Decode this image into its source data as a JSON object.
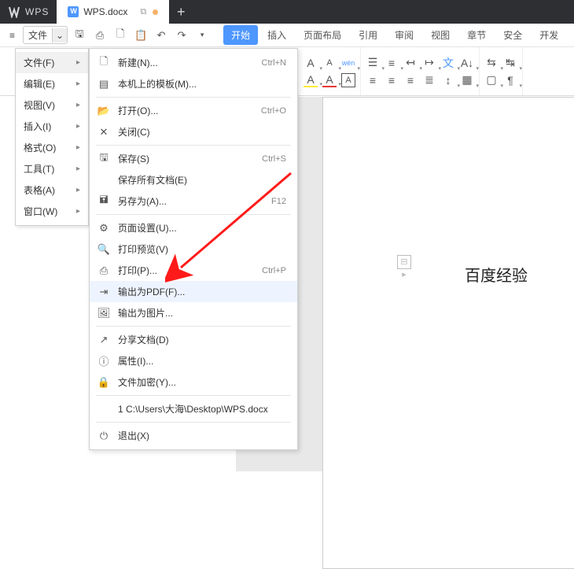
{
  "app": {
    "name": "WPS"
  },
  "tab": {
    "document_name": "WPS.docx"
  },
  "menu": {
    "file_label": "文件",
    "hamburger": "≡"
  },
  "ribbon_tabs": {
    "start": "开始",
    "insert": "插入",
    "layout": "页面布局",
    "reference": "引用",
    "review": "审阅",
    "view": "视图",
    "section": "章节",
    "security": "安全",
    "dev": "开发"
  },
  "file_menu": {
    "items": [
      {
        "label": "文件(F)",
        "has_sub": true,
        "highlighted": true
      },
      {
        "label": "编辑(E)",
        "has_sub": true
      },
      {
        "label": "视图(V)",
        "has_sub": true
      },
      {
        "label": "插入(I)",
        "has_sub": true
      },
      {
        "label": "格式(O)",
        "has_sub": true
      },
      {
        "label": "工具(T)",
        "has_sub": true
      },
      {
        "label": "表格(A)",
        "has_sub": true
      },
      {
        "label": "窗口(W)",
        "has_sub": true
      }
    ]
  },
  "file_ops": {
    "new": {
      "label": "新建(N)...",
      "shortcut": "Ctrl+N"
    },
    "template": {
      "label": "本机上的模板(M)..."
    },
    "open": {
      "label": "打开(O)...",
      "shortcut": "Ctrl+O"
    },
    "close": {
      "label": "关闭(C)"
    },
    "save": {
      "label": "保存(S)",
      "shortcut": "Ctrl+S"
    },
    "save_all": {
      "label": "保存所有文档(E)"
    },
    "save_as": {
      "label": "另存为(A)...",
      "shortcut": "F12"
    },
    "page_setup": {
      "label": "页面设置(U)..."
    },
    "print_preview": {
      "label": "打印预览(V)"
    },
    "print": {
      "label": "打印(P)...",
      "shortcut": "Ctrl+P"
    },
    "export_pdf": {
      "label": "输出为PDF(F)..."
    },
    "export_img": {
      "label": "输出为图片..."
    },
    "share": {
      "label": "分享文档(D)"
    },
    "properties": {
      "label": "属性(I)..."
    },
    "encrypt": {
      "label": "文件加密(Y)..."
    },
    "recent": {
      "label": "1 C:\\Users\\大海\\Desktop\\WPS.docx"
    },
    "exit": {
      "label": "退出(X)"
    }
  },
  "document": {
    "text": "百度经验"
  }
}
